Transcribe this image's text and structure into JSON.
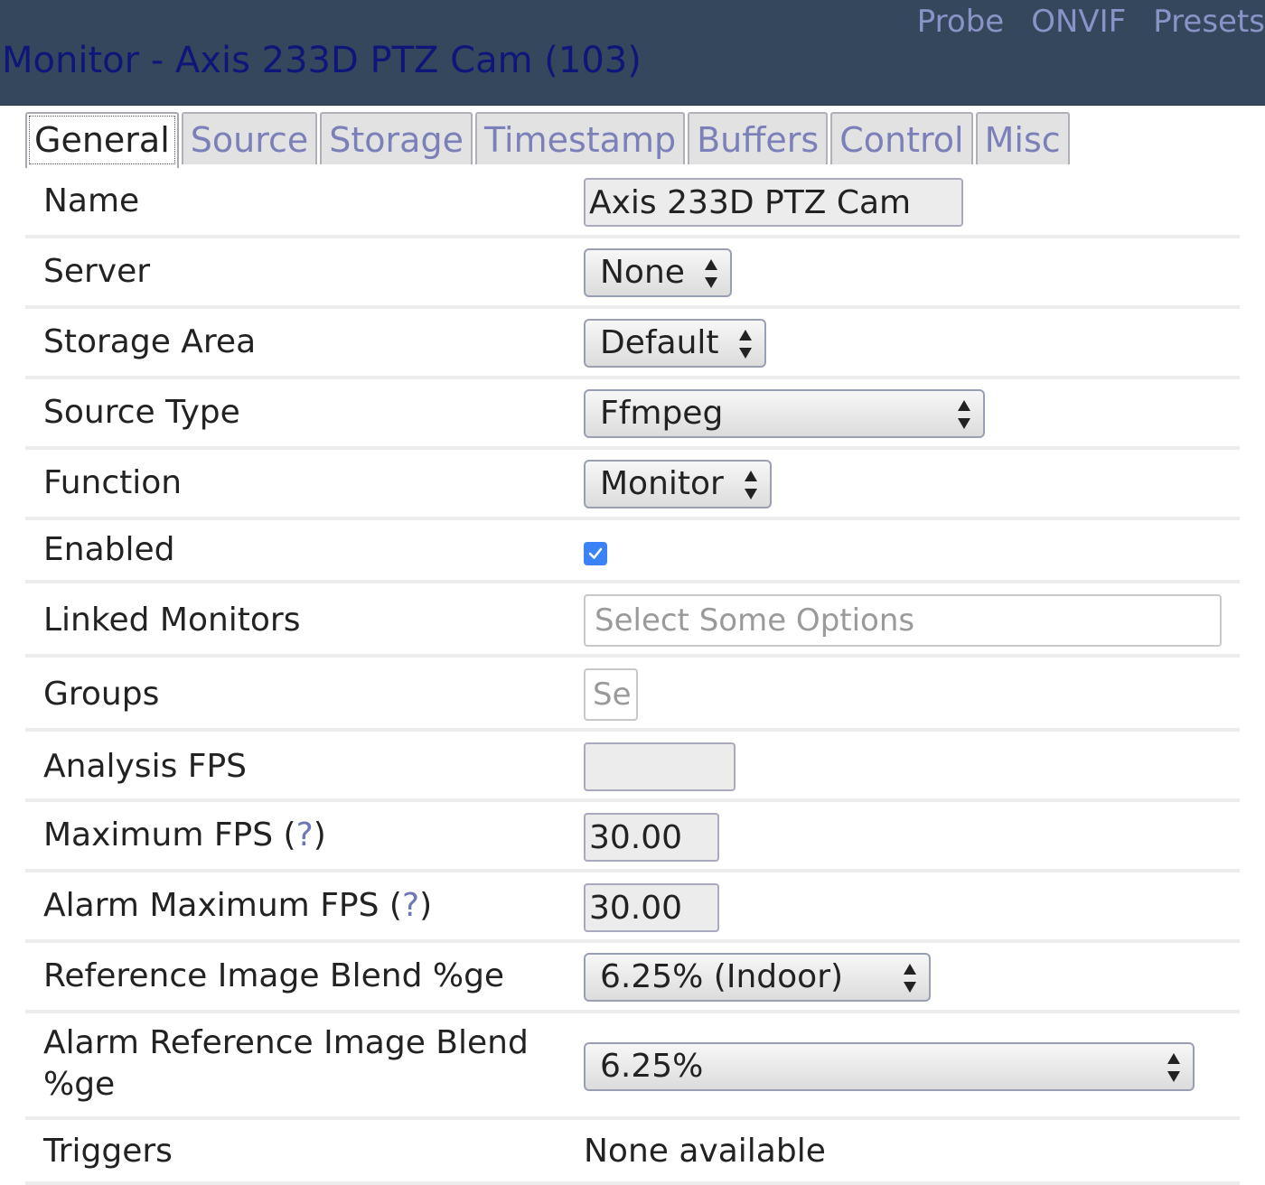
{
  "header": {
    "title": "Monitor - Axis 233D PTZ Cam (103)",
    "links": [
      "Probe",
      "ONVIF",
      "Presets"
    ]
  },
  "tabs": [
    {
      "label": "General",
      "active": true
    },
    {
      "label": "Source"
    },
    {
      "label": "Storage"
    },
    {
      "label": "Timestamp"
    },
    {
      "label": "Buffers"
    },
    {
      "label": "Control"
    },
    {
      "label": "Misc"
    }
  ],
  "form": {
    "name": {
      "label": "Name",
      "value": "Axis 233D PTZ Cam"
    },
    "server": {
      "label": "Server",
      "value": "None"
    },
    "storage_area": {
      "label": "Storage Area",
      "value": "Default"
    },
    "source_type": {
      "label": "Source Type",
      "value": "Ffmpeg"
    },
    "function": {
      "label": "Function",
      "value": "Monitor"
    },
    "enabled": {
      "label": "Enabled",
      "checked": true
    },
    "linked_monitors": {
      "label": "Linked Monitors",
      "placeholder": "Select Some Options"
    },
    "groups": {
      "label": "Groups",
      "placeholder": "Se"
    },
    "analysis_fps": {
      "label": "Analysis FPS",
      "value": ""
    },
    "maximum_fps": {
      "label": "Maximum FPS",
      "help": "?",
      "value": "30.00"
    },
    "alarm_maximum_fps": {
      "label": "Alarm Maximum FPS",
      "help": "?",
      "value": "30.00"
    },
    "ref_blend": {
      "label": "Reference Image Blend %ge",
      "value": "6.25% (Indoor)"
    },
    "alarm_ref_blend": {
      "label_line1": "Alarm Reference Image Blend",
      "label_line2": "%ge",
      "value": "6.25%"
    },
    "triggers": {
      "label": "Triggers",
      "value": "None available"
    }
  },
  "colors": {
    "header_bg": "#34475c",
    "title": "#0e1779",
    "link": "#8a93c7",
    "tab_inactive_text": "#7b80b9",
    "checkbox": "#3b82f6"
  }
}
